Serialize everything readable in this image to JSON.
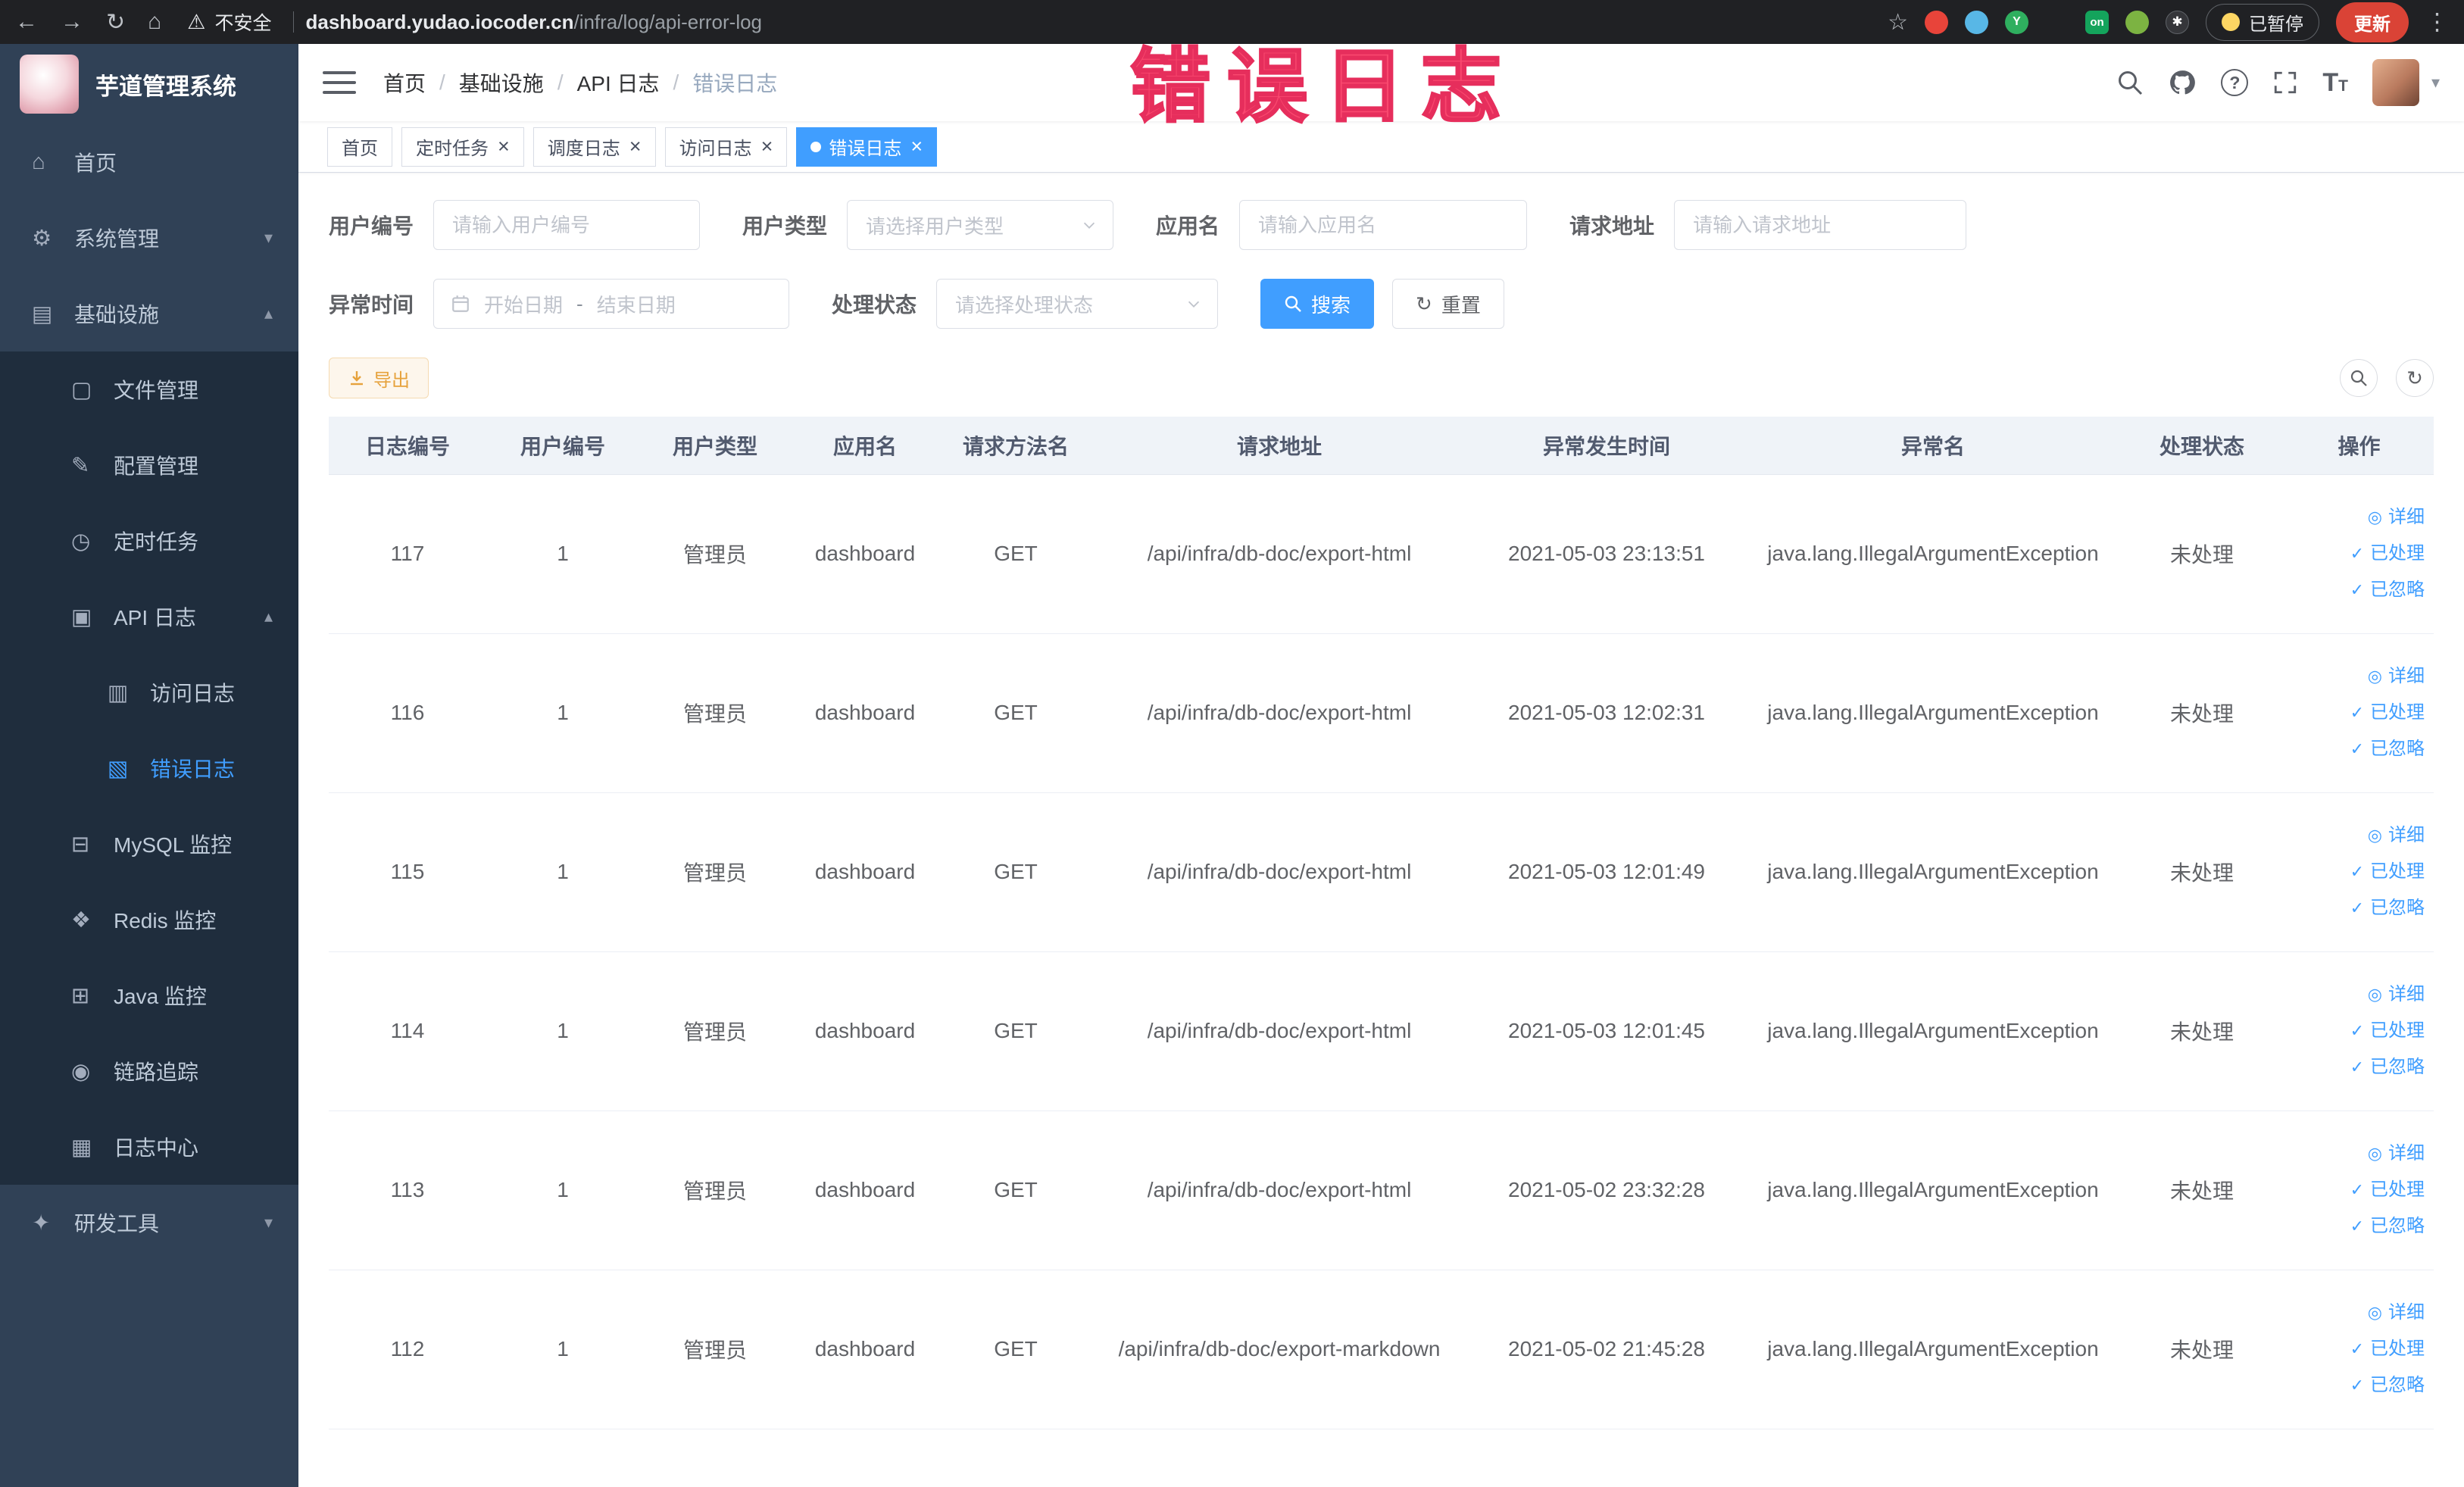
{
  "browser": {
    "security_label": "不安全",
    "url_domain": "dashboard.yudao.iocoder.cn",
    "url_path": "/infra/log/api-error-log",
    "paused_label": "已暂停",
    "update_label": "更新"
  },
  "overlay": {
    "annotation": "错误日志"
  },
  "sidebar": {
    "logo_title": "芋道管理系统",
    "items": [
      {
        "id": "home",
        "label": "首页",
        "glyph": "⌂",
        "icon": "home-icon",
        "level": 0
      },
      {
        "id": "system-mgmt",
        "label": "系统管理",
        "glyph": "⚙",
        "icon": "gear-icon",
        "level": 0,
        "chevron": "down"
      },
      {
        "id": "infrastructure",
        "label": "基础设施",
        "glyph": "▤",
        "icon": "infrastructure-icon",
        "level": 0,
        "chevron": "up"
      },
      {
        "id": "file-mgmt",
        "label": "文件管理",
        "glyph": "▢",
        "icon": "file-icon",
        "level": 1
      },
      {
        "id": "config-mgmt",
        "label": "配置管理",
        "glyph": "✎",
        "icon": "config-icon",
        "level": 1
      },
      {
        "id": "scheduled-jobs",
        "label": "定时任务",
        "glyph": "◷",
        "icon": "clock-icon",
        "level": 1
      },
      {
        "id": "api-log",
        "label": "API 日志",
        "glyph": "▣",
        "icon": "api-log-icon",
        "level": 1,
        "chevron": "up"
      },
      {
        "id": "access-log",
        "label": "访问日志",
        "glyph": "▥",
        "icon": "access-log-icon",
        "level": 2
      },
      {
        "id": "error-log",
        "label": "错误日志",
        "glyph": "▧",
        "icon": "error-log-icon",
        "level": 2,
        "active": true
      },
      {
        "id": "mysql-monitor",
        "label": "MySQL 监控",
        "glyph": "⊟",
        "icon": "mysql-icon",
        "level": 1
      },
      {
        "id": "redis-monitor",
        "label": "Redis 监控",
        "glyph": "❖",
        "icon": "redis-icon",
        "level": 1
      },
      {
        "id": "java-monitor",
        "label": "Java 监控",
        "glyph": "⊞",
        "icon": "java-icon",
        "level": 1
      },
      {
        "id": "trace",
        "label": "链路追踪",
        "glyph": "◉",
        "icon": "trace-icon",
        "level": 1
      },
      {
        "id": "log-center",
        "label": "日志中心",
        "glyph": "▦",
        "icon": "log-center-icon",
        "level": 1
      },
      {
        "id": "dev-tools",
        "label": "研发工具",
        "glyph": "✦",
        "icon": "tools-icon",
        "level": 0,
        "chevron": "down"
      }
    ]
  },
  "header": {
    "breadcrumb": [
      "首页",
      "基础设施",
      "API 日志",
      "错误日志"
    ]
  },
  "tabs": [
    {
      "id": "index",
      "label": "首页",
      "closable": false,
      "active": false
    },
    {
      "id": "job",
      "label": "定时任务",
      "closable": true,
      "active": false
    },
    {
      "id": "job-log",
      "label": "调度日志",
      "closable": true,
      "active": false
    },
    {
      "id": "api-access-log",
      "label": "访问日志",
      "closable": true,
      "active": false
    },
    {
      "id": "api-error-log",
      "label": "错误日志",
      "closable": true,
      "active": true
    }
  ],
  "filters": {
    "user_id": {
      "label": "用户编号",
      "placeholder": "请输入用户编号"
    },
    "user_type": {
      "label": "用户类型",
      "placeholder": "请选择用户类型"
    },
    "app_name": {
      "label": "应用名",
      "placeholder": "请输入应用名"
    },
    "request_url": {
      "label": "请求地址",
      "placeholder": "请输入请求地址"
    },
    "exception_time": {
      "label": "异常时间",
      "start_placeholder": "开始日期",
      "separator": "-",
      "end_placeholder": "结束日期"
    },
    "process_status": {
      "label": "处理状态",
      "placeholder": "请选择处理状态"
    },
    "search_label": "搜索",
    "reset_label": "重置"
  },
  "toolbar": {
    "export_label": "导出"
  },
  "table": {
    "columns": [
      "日志编号",
      "用户编号",
      "用户类型",
      "应用名",
      "请求方法名",
      "请求地址",
      "异常发生时间",
      "异常名",
      "处理状态",
      "操作"
    ],
    "actions": [
      {
        "id": "detail",
        "label": "详细",
        "icon": "eye-icon",
        "glyph": "◎"
      },
      {
        "id": "processed",
        "label": "已处理",
        "icon": "check-icon",
        "glyph": "✓"
      },
      {
        "id": "ignored",
        "label": "已忽略",
        "icon": "check-icon",
        "glyph": "✓"
      }
    ],
    "rows": [
      {
        "id": "117",
        "user_id": "1",
        "user_type": "管理员",
        "app": "dashboard",
        "method": "GET",
        "url": "/api/infra/db-doc/export-html",
        "time": "2021-05-03 23:13:51",
        "exception": "java.lang.IllegalArgumentException",
        "status": "未处理"
      },
      {
        "id": "116",
        "user_id": "1",
        "user_type": "管理员",
        "app": "dashboard",
        "method": "GET",
        "url": "/api/infra/db-doc/export-html",
        "time": "2021-05-03 12:02:31",
        "exception": "java.lang.IllegalArgumentException",
        "status": "未处理"
      },
      {
        "id": "115",
        "user_id": "1",
        "user_type": "管理员",
        "app": "dashboard",
        "method": "GET",
        "url": "/api/infra/db-doc/export-html",
        "time": "2021-05-03 12:01:49",
        "exception": "java.lang.IllegalArgumentException",
        "status": "未处理"
      },
      {
        "id": "114",
        "user_id": "1",
        "user_type": "管理员",
        "app": "dashboard",
        "method": "GET",
        "url": "/api/infra/db-doc/export-html",
        "time": "2021-05-03 12:01:45",
        "exception": "java.lang.IllegalArgumentException",
        "status": "未处理"
      },
      {
        "id": "113",
        "user_id": "1",
        "user_type": "管理员",
        "app": "dashboard",
        "method": "GET",
        "url": "/api/infra/db-doc/export-html",
        "time": "2021-05-02 23:32:28",
        "exception": "java.lang.IllegalArgumentException",
        "status": "未处理"
      },
      {
        "id": "112",
        "user_id": "1",
        "user_type": "管理员",
        "app": "dashboard",
        "method": "GET",
        "url": "/api/infra/db-doc/export-markdown",
        "time": "2021-05-02 21:45:28",
        "exception": "java.lang.IllegalArgumentException",
        "status": "未处理"
      }
    ]
  }
}
